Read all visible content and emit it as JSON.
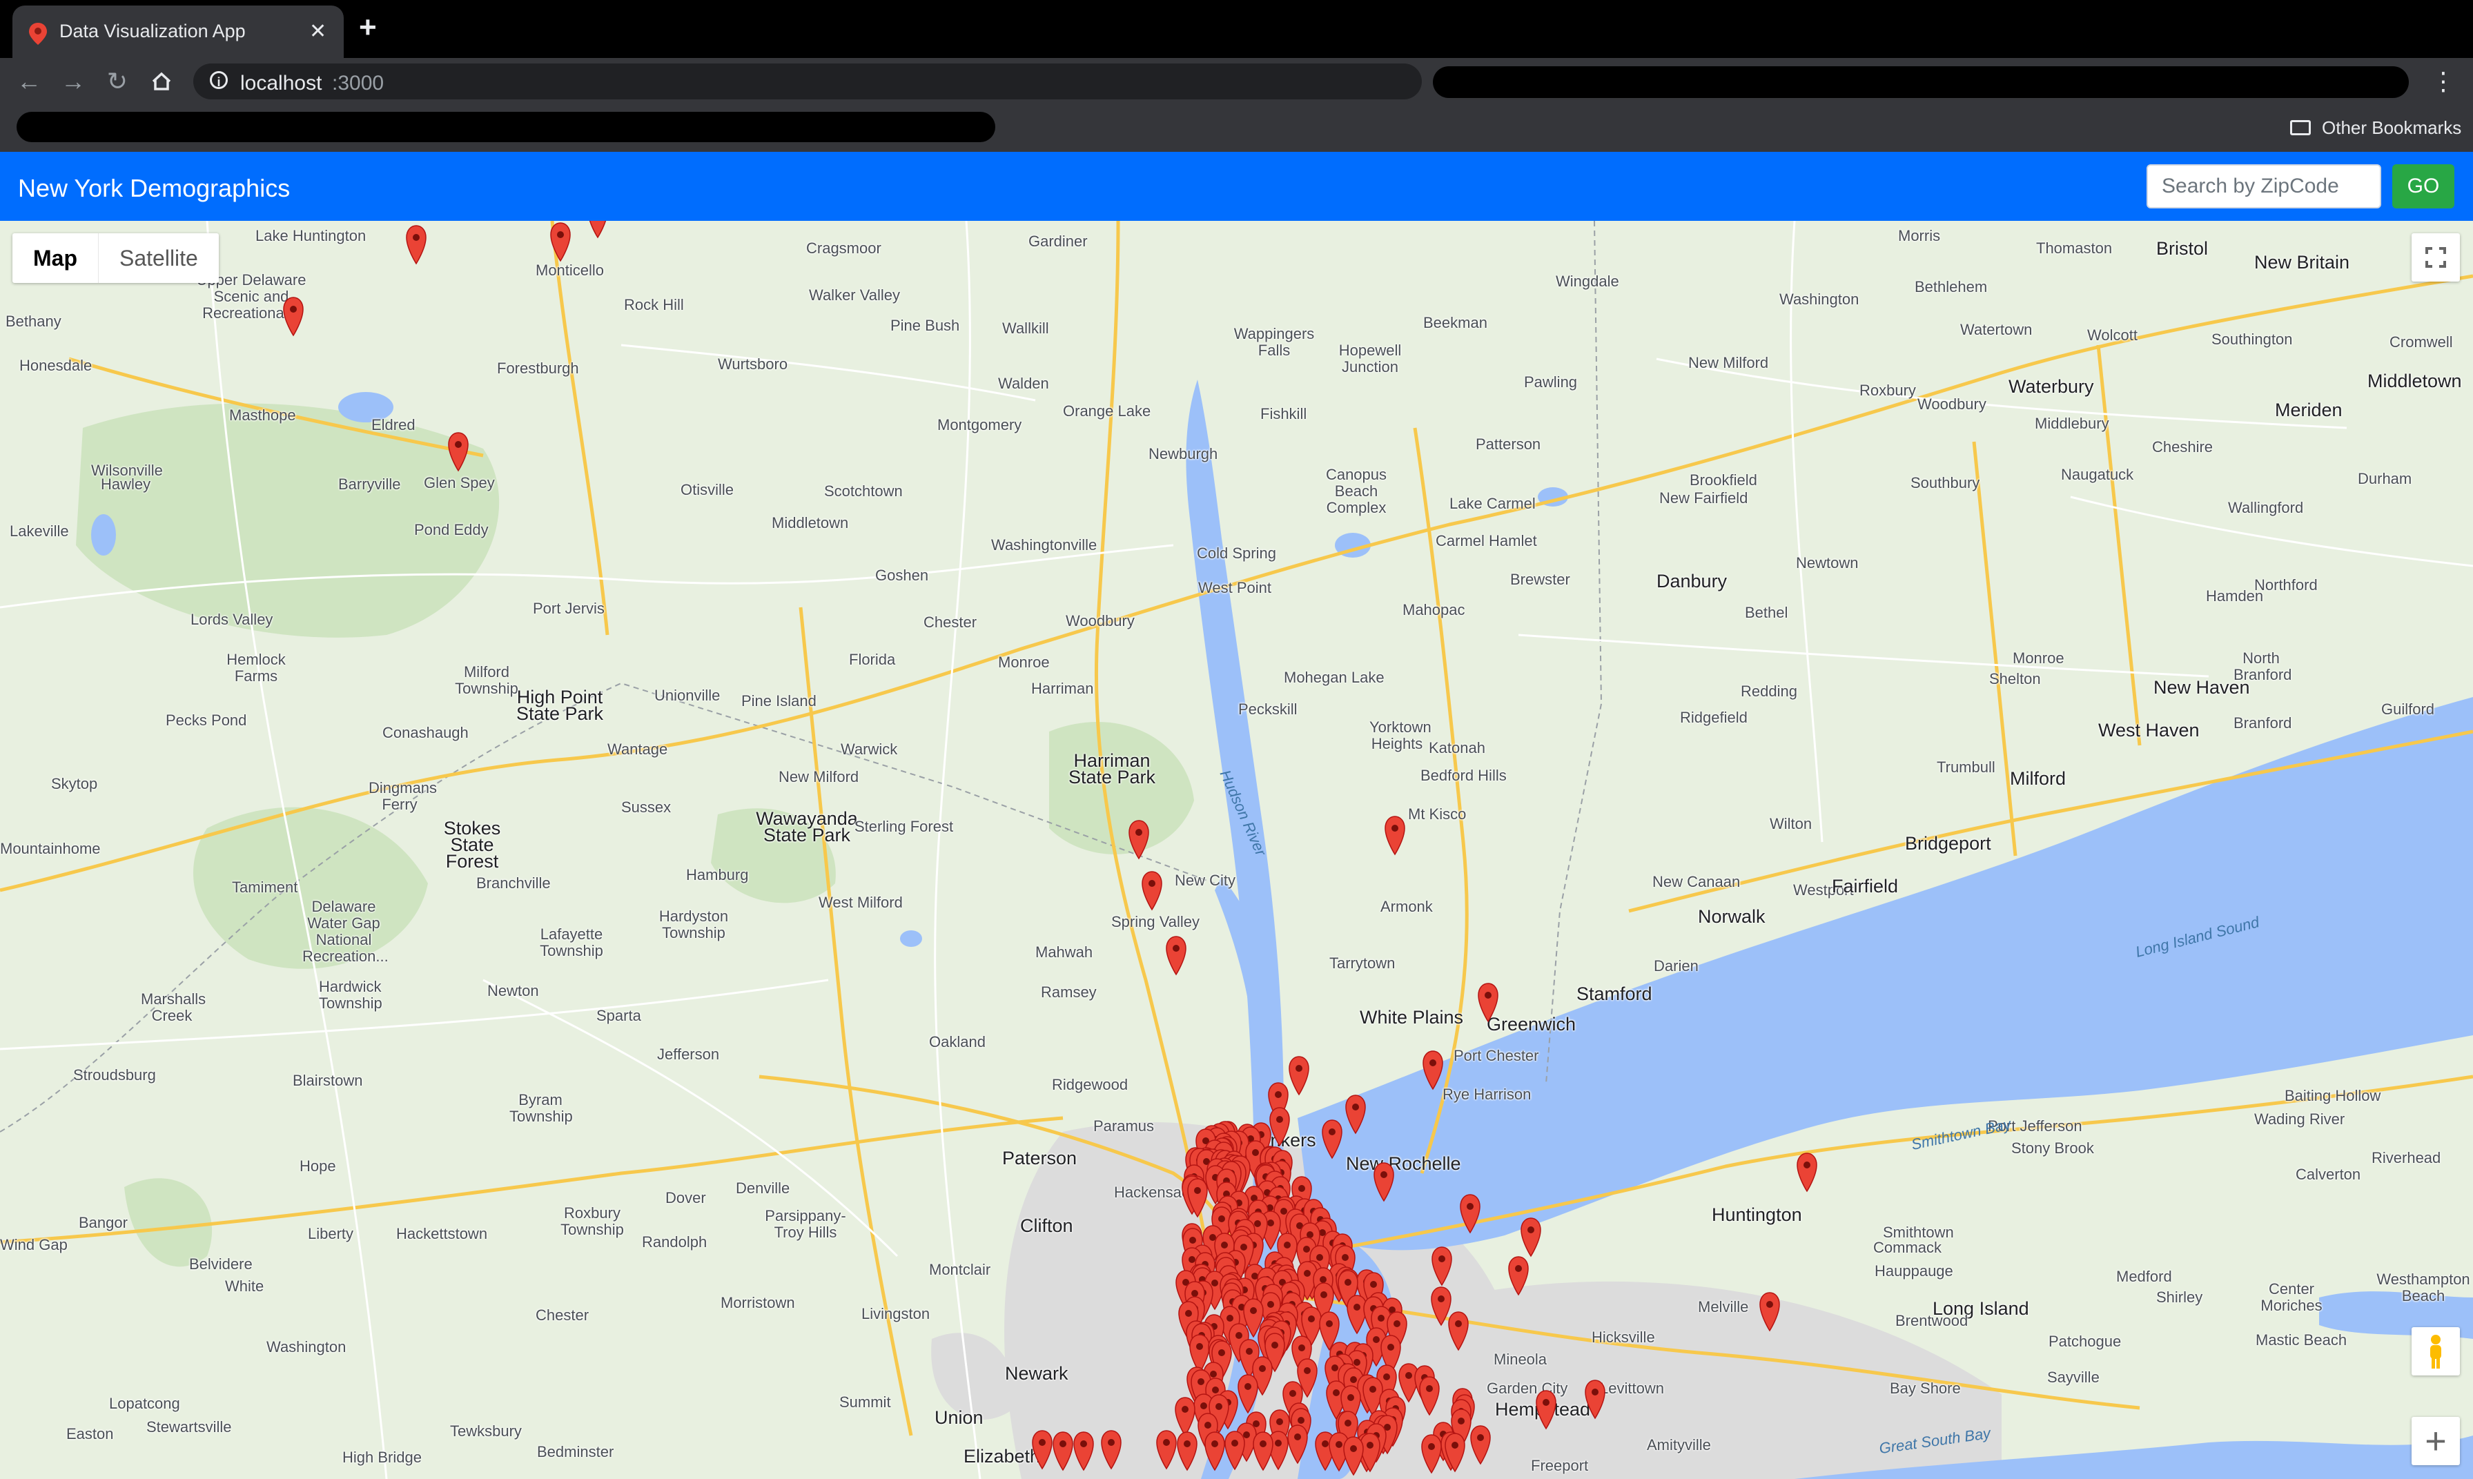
{
  "browser": {
    "tab_title": "Data Visualization App",
    "url_host": "localhost",
    "url_port": ":3000",
    "other_bookmarks": "Other Bookmarks"
  },
  "app": {
    "title": "New York Demographics",
    "search_placeholder": "Search by ZipCode",
    "go_label": "GO"
  },
  "map": {
    "type_controls": [
      "Map",
      "Satellite"
    ],
    "selected_type": "Map",
    "colors": {
      "land": "#e8f0e0",
      "water": "#9cc0f9",
      "marker": "#ea4335",
      "highway": "#f7c84c"
    },
    "places": {
      "p1": "Lake Huntington",
      "p2": "Cragsmoor",
      "p3": "Gardiner",
      "p4": "Morris",
      "p5": "Thomaston",
      "p6": "Bristol",
      "p7": "New Britain",
      "p8": "Upper Delaware Scenic and Recreational...",
      "p9": "Monticello",
      "p10": "Walker Valley",
      "p11": "Rock Hill",
      "p12": "Wingdale",
      "p13": "Washington",
      "p14": "Bethlehem",
      "p15": "Bethany",
      "p16": "Honesdale",
      "p17": "Pine Bush",
      "p18": "Wallkill",
      "p19": "Wappingers Falls",
      "p20": "Hopewell Junction",
      "p21": "Beekman",
      "p22": "Watertown",
      "p23": "Wolcott",
      "p24": "Southington",
      "p25": "Cromwell",
      "p26": "Forestburgh",
      "p27": "Wurtsboro",
      "p28": "Walden",
      "p29": "Pawling",
      "p30": "New Milford",
      "p31": "Roxbury",
      "p32": "Waterbury",
      "p33": "Middletown",
      "p34": "Masthope",
      "p35": "Eldred",
      "p36": "Montgomery",
      "p37": "Orange Lake",
      "p38": "Fishkill",
      "p39": "Woodbury",
      "p40": "Middlebury",
      "p41": "Meriden",
      "p42": "Glen Spey",
      "p43": "Newburgh",
      "p44": "Patterson",
      "p45": "Cheshire",
      "p46": "Hawley",
      "p47": "Wilsonville",
      "p48": "Barryville",
      "p49": "Otisville",
      "p50": "Scotchtown",
      "p51": "Canopus Beach Complex",
      "p52": "Brookfield",
      "p53": "New Fairfield",
      "p54": "Naugatuck",
      "p55": "Southbury",
      "p56": "Durham",
      "p57": "Wallingford",
      "p58": "Lakeville",
      "p59": "Pond Eddy",
      "p60": "Middletown",
      "p61": "Washingtonville",
      "p62": "Lake Carmel",
      "p63": "Carmel Hamlet",
      "p64": "Cold Spring",
      "p65": "Goshen",
      "p66": "Newtown",
      "p67": "Port Jervis",
      "p68": "West Point",
      "p69": "Brewster",
      "p70": "Danbury",
      "p71": "Hamden",
      "p72": "Northford",
      "p73": "Lords Valley",
      "p74": "Chester",
      "p75": "Woodbury",
      "p76": "Mahopac",
      "p77": "Bethel",
      "p78": "Hemlock Farms",
      "p79": "Florida",
      "p80": "Monroe",
      "p81": "Mohegan Lake",
      "p82": "Monroe",
      "p83": "Shelton",
      "p84": "North Branford",
      "p85": "Milford Township",
      "p86": "High Point State Park",
      "p87": "Unionville",
      "p88": "Pine Island",
      "p89": "Harriman",
      "p90": "Redding",
      "p91": "New Haven",
      "p92": "Peckskill",
      "p93": "Pecks Pond",
      "p94": "Conashaugh",
      "p95": "Wantage",
      "p96": "Warwick",
      "p97": "Yorktown Heights",
      "p98": "Ridgefield",
      "p99": "West Haven",
      "p100": "Branford",
      "p101": "Guilford",
      "p102": "Katonah",
      "p103": "Harriman State Park",
      "p104": "Trumbull",
      "p105": "Skytop",
      "p106": "Dingmans Ferry",
      "p107": "New Milford",
      "p108": "Bedford Hills",
      "p109": "Milford",
      "p110": "Sussex",
      "p111": "Wawayanda State Park",
      "p112": "Sterling Forest",
      "p113": "Mt Kisco",
      "p114": "Wilton",
      "p115": "Mountainhome",
      "p116": "Stokes State Forest",
      "p117": "New City",
      "p118": "Bridgeport",
      "p119": "Hamburg",
      "p120": "Spring Valley",
      "p121": "New Canaan",
      "p122": "Westport",
      "p123": "Fairfield",
      "p124": "Tamiment",
      "p125": "Branchville",
      "p126": "West Milford",
      "p127": "Armonk",
      "p128": "Delaware Water Gap National Recreation...",
      "p129": "Hardyston Township",
      "p130": "Norwalk",
      "p131": "Lafayette Township",
      "p132": "Mahwah",
      "p133": "Tarrytown",
      "p134": "Darien",
      "p135": "Long Island Sound",
      "p136": "Hardwick Township",
      "p137": "Ramsey",
      "p138": "Marshalls Creek",
      "p139": "Newton",
      "p140": "Sparta",
      "p141": "Stamford",
      "p142": "White Plains",
      "p143": "Greenwich",
      "p144": "Oakland",
      "p145": "Jefferson",
      "p146": "Port Chester",
      "p147": "Stroudsburg",
      "p148": "Blairstown",
      "p149": "Ridgewood",
      "p150": "Rye Harrison",
      "p151": "Baiting Hollow",
      "p152": "Byram Township",
      "p153": "Paramus",
      "p154": "Wading River",
      "p155": "Port Jefferson",
      "p156": "Smithtown Bay",
      "p157": "Stony Brook",
      "p158": "Yonkers",
      "p159": "Hope",
      "p160": "Paterson",
      "p161": "New Rochelle",
      "p162": "Riverhead",
      "p163": "Calverton",
      "p164": "Denville",
      "p165": "Hackensack",
      "p166": "Huntington",
      "p167": "Smithtown",
      "p168": "Bangor",
      "p169": "Roxbury Township",
      "p170": "Parsippany-Troy Hills",
      "p171": "Liberty",
      "p172": "Hackettstown",
      "p173": "Dover",
      "p174": "Clifton",
      "p175": "Commack",
      "p176": "Randolph",
      "p177": "Hauppauge",
      "p178": "Wind Gap",
      "p179": "Belvidere",
      "p180": "Medford",
      "p181": "Westhampton Beach",
      "p182": "White",
      "p183": "Montclair",
      "p184": "Melville",
      "p185": "Long Island",
      "p186": "Brentwood",
      "p187": "Shirley",
      "p188": "Center Moriches",
      "p189": "Morristown",
      "p190": "Livingston",
      "p191": "Chester",
      "p192": "Hicksville",
      "p193": "Mastic Beach",
      "p194": "Washington",
      "p195": "Patchogue",
      "p196": "Mineola",
      "p197": "Newark",
      "p198": "Garden City",
      "p199": "Bay Shore",
      "p200": "Sayville",
      "p201": "Hempstead",
      "p202": "Levittown",
      "p203": "Lopatcong",
      "p204": "Summit",
      "p205": "Stewartsville",
      "p206": "Union",
      "p207": "Tewksbury",
      "p208": "Amityville",
      "p209": "Easton",
      "p210": "Bedminster",
      "p211": "High Bridge",
      "p212": "Elizabeth",
      "p213": "Great South Bay",
      "p214": "Freeport",
      "p215": "Hudson River",
      "p216": "Newburgh"
    }
  }
}
